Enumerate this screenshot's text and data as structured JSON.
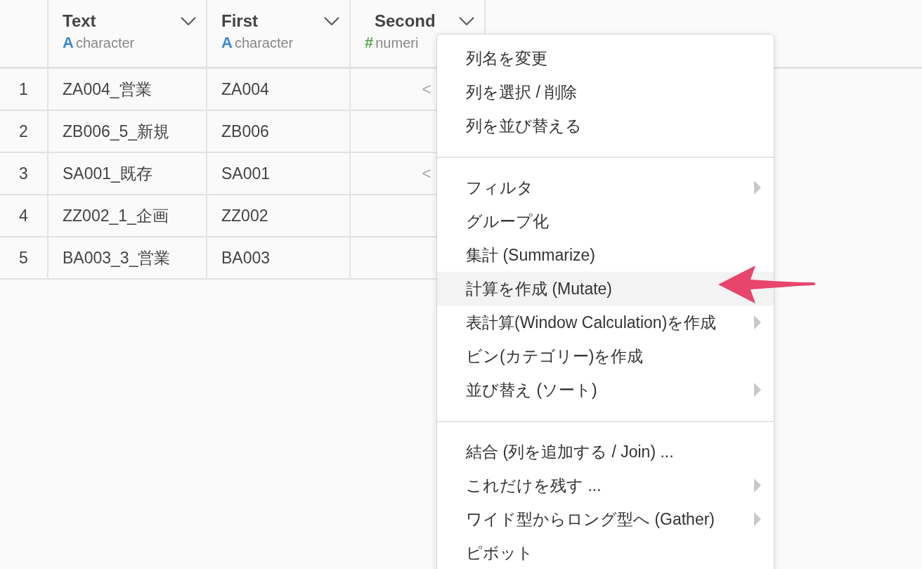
{
  "columns": [
    {
      "name": "Text",
      "kind": "character",
      "icon": "A",
      "type": "character"
    },
    {
      "name": "First",
      "kind": "character",
      "icon": "A",
      "type": "character"
    },
    {
      "name": "Second",
      "kind": "numeric",
      "icon": "#",
      "type": "numeri"
    }
  ],
  "rows": [
    {
      "index": "1",
      "text": "ZA004_営業",
      "first": "ZA004",
      "second": "<"
    },
    {
      "index": "2",
      "text": "ZB006_5_新規",
      "first": "ZB006"
    },
    {
      "index": "3",
      "text": "SA001_既存",
      "first": "SA001",
      "second": "<"
    },
    {
      "index": "4",
      "text": "ZZ002_1_企画",
      "first": "ZZ002"
    },
    {
      "index": "5",
      "text": "BA003_3_営業",
      "first": "BA003"
    }
  ],
  "menu": {
    "sections": [
      {
        "items": [
          {
            "label": "列名を変更",
            "submenu": false,
            "selected": false
          },
          {
            "label": "列を選択 / 削除",
            "submenu": false,
            "selected": false
          },
          {
            "label": "列を並び替える",
            "submenu": false,
            "selected": false
          }
        ]
      },
      {
        "items": [
          {
            "label": "フィルタ",
            "submenu": true,
            "selected": false
          },
          {
            "label": "グループ化",
            "submenu": false,
            "selected": false
          },
          {
            "label": "集計 (Summarize)",
            "submenu": false,
            "selected": false
          },
          {
            "label": "計算を作成 (Mutate)",
            "submenu": false,
            "selected": true
          },
          {
            "label": "表計算(Window Calculation)を作成",
            "submenu": true,
            "selected": false
          },
          {
            "label": "ビン(カテゴリー)を作成",
            "submenu": false,
            "selected": false
          },
          {
            "label": "並び替え (ソート)",
            "submenu": true,
            "selected": false
          }
        ]
      },
      {
        "items": [
          {
            "label": "結合 (列を追加する / Join) ...",
            "submenu": false,
            "selected": false
          },
          {
            "label": "これだけを残す ...",
            "submenu": true,
            "selected": false
          },
          {
            "label": "ワイド型からロング型へ (Gather)",
            "submenu": true,
            "selected": false
          },
          {
            "label": "ピボット",
            "submenu": false,
            "selected": false
          }
        ]
      }
    ]
  }
}
